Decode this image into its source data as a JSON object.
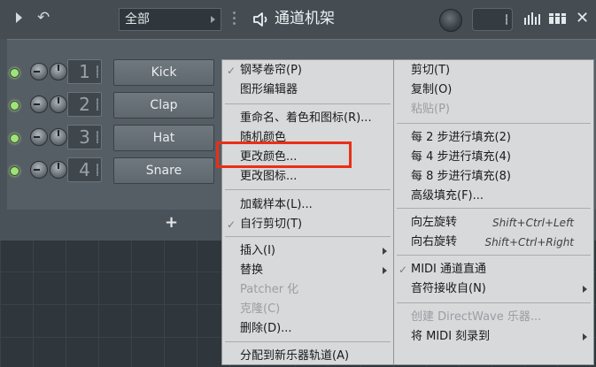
{
  "window": {
    "filter_value": "全部",
    "title": "通道机架"
  },
  "channels": [
    {
      "number": "1",
      "name": "Kick"
    },
    {
      "number": "2",
      "name": "Clap"
    },
    {
      "number": "3",
      "name": "Hat"
    },
    {
      "number": "4",
      "name": "Snare"
    }
  ],
  "add_label": "+",
  "menu_left": [
    {
      "label": "钢琴卷帘(P)",
      "checked": true
    },
    {
      "label": "图形编辑器"
    },
    {
      "label": "重命名、着色和图标(R)..."
    },
    {
      "label": "随机颜色"
    },
    {
      "label": "更改颜色..."
    },
    {
      "label": "更改图标..."
    },
    {
      "label": "加载样本(L)..."
    },
    {
      "label": "自行剪切(T)",
      "checked": true
    },
    {
      "label": "插入(I)",
      "submenu": true
    },
    {
      "label": "替换",
      "submenu": true
    },
    {
      "label": "Patcher 化",
      "disabled": true
    },
    {
      "label": "克隆(C)",
      "disabled": true
    },
    {
      "label": "删除(D)..."
    },
    {
      "label": "分配到新乐器轨道(A)"
    }
  ],
  "menu_right": [
    {
      "label": "剪切(T)"
    },
    {
      "label": "复制(O)"
    },
    {
      "label": "粘贴(P)",
      "disabled": true
    },
    {
      "label": "每 2 步进行填充(2)"
    },
    {
      "label": "每 4 步进行填充(4)"
    },
    {
      "label": "每 8 步进行填充(8)"
    },
    {
      "label": "高级填充(F)..."
    },
    {
      "label": "向左旋转",
      "shortcut": "Shift+Ctrl+Left"
    },
    {
      "label": "向右旋转",
      "shortcut": "Shift+Ctrl+Right"
    },
    {
      "label": "MIDI 通道直通",
      "checked": true
    },
    {
      "label": "音符接收自(N)",
      "submenu": true
    },
    {
      "label": "创建 DirectWave 乐器...",
      "disabled": true
    },
    {
      "label": "将 MIDI 刻录到",
      "submenu": true
    }
  ],
  "colors": {
    "highlight": "#ea2f17",
    "led": "#9ee37a"
  }
}
